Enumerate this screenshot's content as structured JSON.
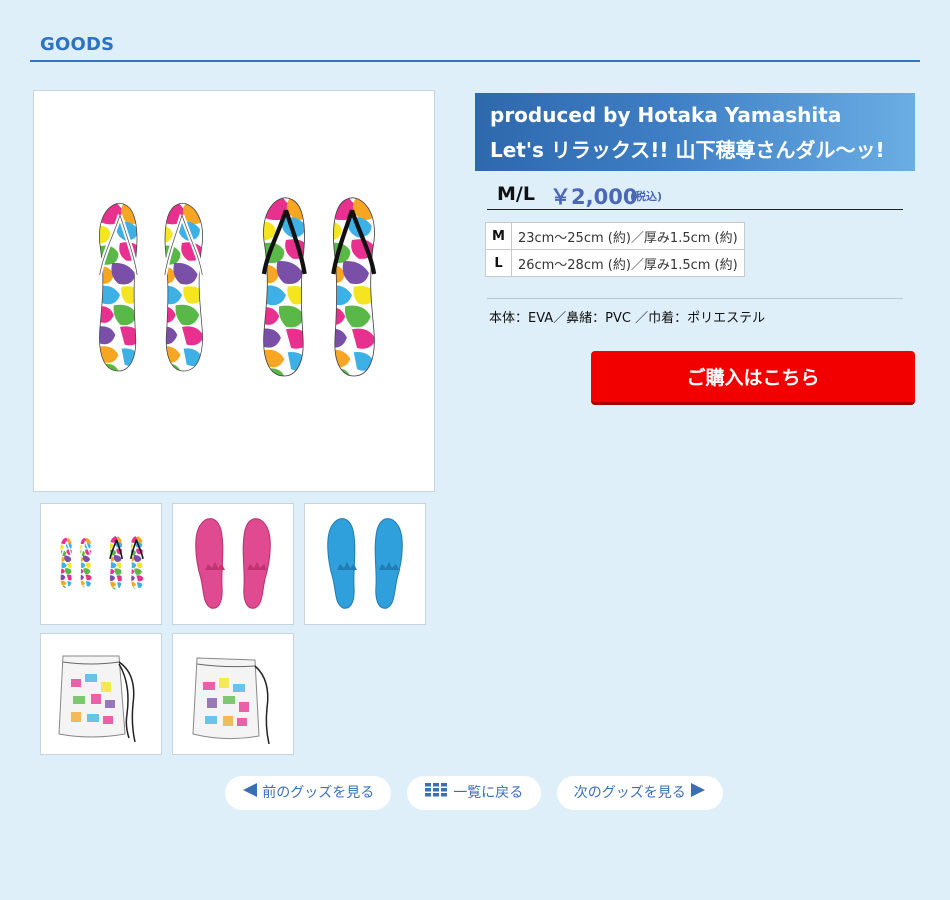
{
  "section_title": "GOODS",
  "product": {
    "title_line1": "produced by Hotaka Yamashita",
    "title_line2": "Let's リラックス!! 山下穂尊さんダル〜ッ!",
    "size_label": "M/L",
    "price": "￥2,000",
    "tax_note": "(税込)",
    "sizes": [
      {
        "size": "M",
        "detail": "23cm〜25cm (約)／厚み1.5cm (約)"
      },
      {
        "size": "L",
        "detail": "26cm〜28cm (約)／厚み1.5cm (約)"
      }
    ],
    "material": "本体：EVA／鼻緒：PVC ／巾着：ポリエステル",
    "buy_label": "ご購入はこちら"
  },
  "thumbnails": [
    {
      "name": "colorful-sandals-pair"
    },
    {
      "name": "pink-sandal-soles"
    },
    {
      "name": "blue-sandal-soles"
    },
    {
      "name": "drawstring-bag-front"
    },
    {
      "name": "drawstring-bag-angle"
    }
  ],
  "nav": {
    "prev_label": "前のグッズを見る",
    "list_label": "一覧に戻る",
    "next_label": "次のグッズを見る"
  },
  "colors": {
    "background": "#dfeffa",
    "accent": "#2d73c2",
    "buy_button": "#f20000",
    "price": "#4a67b8"
  }
}
